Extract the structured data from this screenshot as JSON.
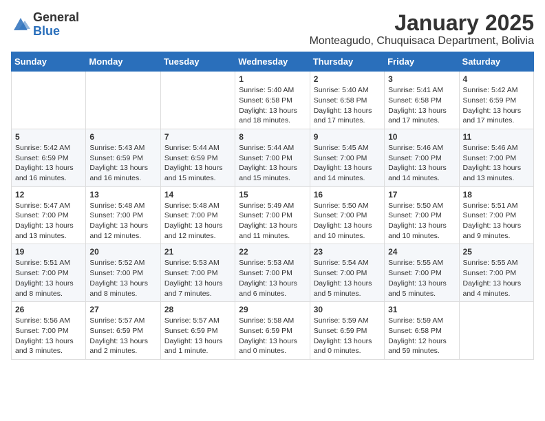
{
  "logo": {
    "text_general": "General",
    "text_blue": "Blue"
  },
  "title": "January 2025",
  "location": "Monteagudo, Chuquisaca Department, Bolivia",
  "weekdays": [
    "Sunday",
    "Monday",
    "Tuesday",
    "Wednesday",
    "Thursday",
    "Friday",
    "Saturday"
  ],
  "weeks": [
    [
      {
        "day": "",
        "sunrise": "",
        "sunset": "",
        "daylight": ""
      },
      {
        "day": "",
        "sunrise": "",
        "sunset": "",
        "daylight": ""
      },
      {
        "day": "",
        "sunrise": "",
        "sunset": "",
        "daylight": ""
      },
      {
        "day": "1",
        "sunrise": "Sunrise: 5:40 AM",
        "sunset": "Sunset: 6:58 PM",
        "daylight": "Daylight: 13 hours and 18 minutes."
      },
      {
        "day": "2",
        "sunrise": "Sunrise: 5:40 AM",
        "sunset": "Sunset: 6:58 PM",
        "daylight": "Daylight: 13 hours and 17 minutes."
      },
      {
        "day": "3",
        "sunrise": "Sunrise: 5:41 AM",
        "sunset": "Sunset: 6:58 PM",
        "daylight": "Daylight: 13 hours and 17 minutes."
      },
      {
        "day": "4",
        "sunrise": "Sunrise: 5:42 AM",
        "sunset": "Sunset: 6:59 PM",
        "daylight": "Daylight: 13 hours and 17 minutes."
      }
    ],
    [
      {
        "day": "5",
        "sunrise": "Sunrise: 5:42 AM",
        "sunset": "Sunset: 6:59 PM",
        "daylight": "Daylight: 13 hours and 16 minutes."
      },
      {
        "day": "6",
        "sunrise": "Sunrise: 5:43 AM",
        "sunset": "Sunset: 6:59 PM",
        "daylight": "Daylight: 13 hours and 16 minutes."
      },
      {
        "day": "7",
        "sunrise": "Sunrise: 5:44 AM",
        "sunset": "Sunset: 6:59 PM",
        "daylight": "Daylight: 13 hours and 15 minutes."
      },
      {
        "day": "8",
        "sunrise": "Sunrise: 5:44 AM",
        "sunset": "Sunset: 7:00 PM",
        "daylight": "Daylight: 13 hours and 15 minutes."
      },
      {
        "day": "9",
        "sunrise": "Sunrise: 5:45 AM",
        "sunset": "Sunset: 7:00 PM",
        "daylight": "Daylight: 13 hours and 14 minutes."
      },
      {
        "day": "10",
        "sunrise": "Sunrise: 5:46 AM",
        "sunset": "Sunset: 7:00 PM",
        "daylight": "Daylight: 13 hours and 14 minutes."
      },
      {
        "day": "11",
        "sunrise": "Sunrise: 5:46 AM",
        "sunset": "Sunset: 7:00 PM",
        "daylight": "Daylight: 13 hours and 13 minutes."
      }
    ],
    [
      {
        "day": "12",
        "sunrise": "Sunrise: 5:47 AM",
        "sunset": "Sunset: 7:00 PM",
        "daylight": "Daylight: 13 hours and 13 minutes."
      },
      {
        "day": "13",
        "sunrise": "Sunrise: 5:48 AM",
        "sunset": "Sunset: 7:00 PM",
        "daylight": "Daylight: 13 hours and 12 minutes."
      },
      {
        "day": "14",
        "sunrise": "Sunrise: 5:48 AM",
        "sunset": "Sunset: 7:00 PM",
        "daylight": "Daylight: 13 hours and 12 minutes."
      },
      {
        "day": "15",
        "sunrise": "Sunrise: 5:49 AM",
        "sunset": "Sunset: 7:00 PM",
        "daylight": "Daylight: 13 hours and 11 minutes."
      },
      {
        "day": "16",
        "sunrise": "Sunrise: 5:50 AM",
        "sunset": "Sunset: 7:00 PM",
        "daylight": "Daylight: 13 hours and 10 minutes."
      },
      {
        "day": "17",
        "sunrise": "Sunrise: 5:50 AM",
        "sunset": "Sunset: 7:00 PM",
        "daylight": "Daylight: 13 hours and 10 minutes."
      },
      {
        "day": "18",
        "sunrise": "Sunrise: 5:51 AM",
        "sunset": "Sunset: 7:00 PM",
        "daylight": "Daylight: 13 hours and 9 minutes."
      }
    ],
    [
      {
        "day": "19",
        "sunrise": "Sunrise: 5:51 AM",
        "sunset": "Sunset: 7:00 PM",
        "daylight": "Daylight: 13 hours and 8 minutes."
      },
      {
        "day": "20",
        "sunrise": "Sunrise: 5:52 AM",
        "sunset": "Sunset: 7:00 PM",
        "daylight": "Daylight: 13 hours and 8 minutes."
      },
      {
        "day": "21",
        "sunrise": "Sunrise: 5:53 AM",
        "sunset": "Sunset: 7:00 PM",
        "daylight": "Daylight: 13 hours and 7 minutes."
      },
      {
        "day": "22",
        "sunrise": "Sunrise: 5:53 AM",
        "sunset": "Sunset: 7:00 PM",
        "daylight": "Daylight: 13 hours and 6 minutes."
      },
      {
        "day": "23",
        "sunrise": "Sunrise: 5:54 AM",
        "sunset": "Sunset: 7:00 PM",
        "daylight": "Daylight: 13 hours and 5 minutes."
      },
      {
        "day": "24",
        "sunrise": "Sunrise: 5:55 AM",
        "sunset": "Sunset: 7:00 PM",
        "daylight": "Daylight: 13 hours and 5 minutes."
      },
      {
        "day": "25",
        "sunrise": "Sunrise: 5:55 AM",
        "sunset": "Sunset: 7:00 PM",
        "daylight": "Daylight: 13 hours and 4 minutes."
      }
    ],
    [
      {
        "day": "26",
        "sunrise": "Sunrise: 5:56 AM",
        "sunset": "Sunset: 7:00 PM",
        "daylight": "Daylight: 13 hours and 3 minutes."
      },
      {
        "day": "27",
        "sunrise": "Sunrise: 5:57 AM",
        "sunset": "Sunset: 6:59 PM",
        "daylight": "Daylight: 13 hours and 2 minutes."
      },
      {
        "day": "28",
        "sunrise": "Sunrise: 5:57 AM",
        "sunset": "Sunset: 6:59 PM",
        "daylight": "Daylight: 13 hours and 1 minute."
      },
      {
        "day": "29",
        "sunrise": "Sunrise: 5:58 AM",
        "sunset": "Sunset: 6:59 PM",
        "daylight": "Daylight: 13 hours and 0 minutes."
      },
      {
        "day": "30",
        "sunrise": "Sunrise: 5:59 AM",
        "sunset": "Sunset: 6:59 PM",
        "daylight": "Daylight: 13 hours and 0 minutes."
      },
      {
        "day": "31",
        "sunrise": "Sunrise: 5:59 AM",
        "sunset": "Sunset: 6:58 PM",
        "daylight": "Daylight: 12 hours and 59 minutes."
      },
      {
        "day": "",
        "sunrise": "",
        "sunset": "",
        "daylight": ""
      }
    ]
  ]
}
